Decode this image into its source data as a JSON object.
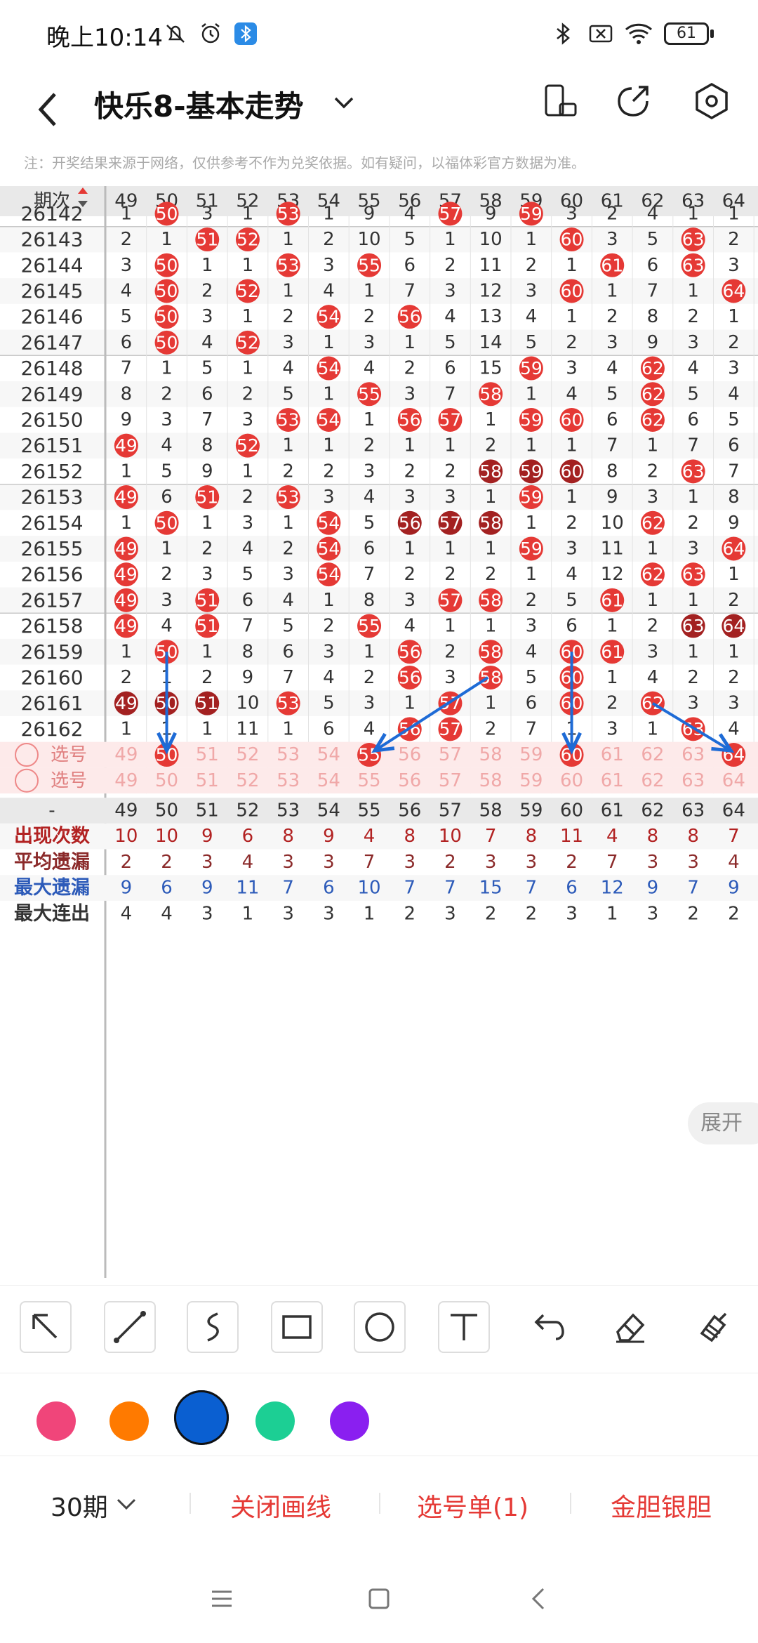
{
  "status": {
    "time": "晚上10:14",
    "battery": "61"
  },
  "app": {
    "title": "快乐8-基本走势"
  },
  "notice": "注：开奖结果来源于网络，仅供参考不作为兑奖依据。如有疑问，以福体彩官方数据为准。",
  "columns": [
    "49",
    "50",
    "51",
    "52",
    "53",
    "54",
    "55",
    "56",
    "57",
    "58",
    "59",
    "60",
    "61",
    "62",
    "63",
    "64"
  ],
  "header_label": "期次",
  "rows": [
    {
      "issue": "26142",
      "cells": [
        "1",
        "50",
        "3",
        "1",
        "53",
        "1",
        "9",
        "4",
        "57",
        "9",
        "59",
        "3",
        "2",
        "4",
        "1",
        "1"
      ],
      "hits": [
        1,
        4,
        8,
        10
      ]
    },
    {
      "issue": "26143",
      "cells": [
        "2",
        "1",
        "51",
        "52",
        "1",
        "2",
        "10",
        "5",
        "1",
        "10",
        "1",
        "60",
        "3",
        "5",
        "63",
        "2"
      ],
      "hits": [
        2,
        3,
        11,
        14
      ]
    },
    {
      "issue": "26144",
      "cells": [
        "3",
        "50",
        "1",
        "1",
        "53",
        "3",
        "55",
        "6",
        "2",
        "11",
        "2",
        "1",
        "61",
        "6",
        "63",
        "3"
      ],
      "hits": [
        1,
        4,
        6,
        12,
        14
      ]
    },
    {
      "issue": "26145",
      "cells": [
        "4",
        "50",
        "2",
        "52",
        "1",
        "4",
        "1",
        "7",
        "3",
        "12",
        "3",
        "60",
        "1",
        "7",
        "1",
        "64"
      ],
      "hits": [
        1,
        3,
        11,
        15
      ]
    },
    {
      "issue": "26146",
      "cells": [
        "5",
        "50",
        "3",
        "1",
        "2",
        "54",
        "2",
        "56",
        "4",
        "13",
        "4",
        "1",
        "2",
        "8",
        "2",
        "1"
      ],
      "hits": [
        1,
        5,
        7
      ]
    },
    {
      "issue": "26147",
      "cells": [
        "6",
        "50",
        "4",
        "52",
        "3",
        "1",
        "3",
        "1",
        "5",
        "14",
        "5",
        "2",
        "3",
        "9",
        "3",
        "2"
      ],
      "hits": [
        1,
        3
      ]
    },
    {
      "issue": "26148",
      "cells": [
        "7",
        "1",
        "5",
        "1",
        "4",
        "54",
        "4",
        "2",
        "6",
        "15",
        "59",
        "3",
        "4",
        "62",
        "4",
        "3"
      ],
      "hits": [
        5,
        10,
        13
      ]
    },
    {
      "issue": "26149",
      "cells": [
        "8",
        "2",
        "6",
        "2",
        "5",
        "1",
        "55",
        "3",
        "7",
        "58",
        "1",
        "4",
        "5",
        "62",
        "5",
        "4"
      ],
      "hits": [
        6,
        9,
        13
      ]
    },
    {
      "issue": "26150",
      "cells": [
        "9",
        "3",
        "7",
        "3",
        "53",
        "54",
        "1",
        "56",
        "57",
        "1",
        "59",
        "60",
        "6",
        "62",
        "6",
        "5"
      ],
      "hits": [
        4,
        5,
        7,
        8,
        10,
        11,
        13
      ]
    },
    {
      "issue": "26151",
      "cells": [
        "49",
        "4",
        "8",
        "52",
        "1",
        "1",
        "2",
        "1",
        "1",
        "2",
        "1",
        "1",
        "7",
        "1",
        "7",
        "6"
      ],
      "hits": [
        0,
        3
      ]
    },
    {
      "issue": "26152",
      "cells": [
        "1",
        "5",
        "9",
        "1",
        "2",
        "2",
        "3",
        "2",
        "2",
        "58",
        "59",
        "60",
        "8",
        "2",
        "63",
        "7"
      ],
      "hits": [
        14
      ],
      "darkhits": [
        9,
        10,
        11
      ]
    },
    {
      "issue": "26153",
      "cells": [
        "49",
        "6",
        "51",
        "2",
        "53",
        "3",
        "4",
        "3",
        "3",
        "1",
        "59",
        "1",
        "9",
        "3",
        "1",
        "8"
      ],
      "hits": [
        0,
        2,
        4,
        10
      ]
    },
    {
      "issue": "26154",
      "cells": [
        "1",
        "50",
        "1",
        "3",
        "1",
        "54",
        "5",
        "56",
        "57",
        "58",
        "1",
        "2",
        "10",
        "62",
        "2",
        "9"
      ],
      "hits": [
        1,
        5,
        13
      ],
      "darkhits": [
        7,
        8,
        9
      ]
    },
    {
      "issue": "26155",
      "cells": [
        "49",
        "1",
        "2",
        "4",
        "2",
        "54",
        "6",
        "1",
        "1",
        "1",
        "59",
        "3",
        "11",
        "1",
        "3",
        "64"
      ],
      "hits": [
        0,
        5,
        10,
        15
      ]
    },
    {
      "issue": "26156",
      "cells": [
        "49",
        "2",
        "3",
        "5",
        "3",
        "54",
        "7",
        "2",
        "2",
        "2",
        "1",
        "4",
        "12",
        "62",
        "63",
        "1"
      ],
      "hits": [
        0,
        5,
        13,
        14
      ]
    },
    {
      "issue": "26157",
      "cells": [
        "49",
        "3",
        "51",
        "6",
        "4",
        "1",
        "8",
        "3",
        "57",
        "58",
        "2",
        "5",
        "61",
        "1",
        "1",
        "2"
      ],
      "hits": [
        0,
        2,
        8,
        9,
        12
      ]
    },
    {
      "issue": "26158",
      "cells": [
        "49",
        "4",
        "51",
        "7",
        "5",
        "2",
        "55",
        "4",
        "1",
        "1",
        "3",
        "6",
        "1",
        "2",
        "63",
        "64"
      ],
      "hits": [
        0,
        2,
        6
      ],
      "darkhits": [
        14,
        15
      ]
    },
    {
      "issue": "26159",
      "cells": [
        "1",
        "50",
        "1",
        "8",
        "6",
        "3",
        "1",
        "56",
        "2",
        "58",
        "4",
        "60",
        "61",
        "3",
        "1",
        "1"
      ],
      "hits": [
        1,
        7,
        9,
        11,
        12
      ]
    },
    {
      "issue": "26160",
      "cells": [
        "2",
        "1",
        "2",
        "9",
        "7",
        "4",
        "2",
        "56",
        "3",
        "58",
        "5",
        "60",
        "1",
        "4",
        "2",
        "2"
      ],
      "hits": [
        7,
        9,
        11
      ]
    },
    {
      "issue": "26161",
      "cells": [
        "49",
        "50",
        "51",
        "10",
        "53",
        "5",
        "3",
        "1",
        "57",
        "1",
        "6",
        "60",
        "2",
        "62",
        "3",
        "3"
      ],
      "hits": [
        4,
        8,
        11,
        13
      ],
      "darkhits": [
        0,
        1,
        2
      ]
    },
    {
      "issue": "26162",
      "cells": [
        "1",
        "1",
        "1",
        "11",
        "1",
        "6",
        "4",
        "56",
        "57",
        "2",
        "7",
        "1",
        "3",
        "1",
        "63",
        "4"
      ],
      "hits": [
        7,
        8,
        14
      ]
    }
  ],
  "select_rows": [
    {
      "label": "选号",
      "selected": [
        1,
        6,
        11,
        15
      ]
    },
    {
      "label": "选号",
      "selected": []
    }
  ],
  "stats_header_label": "-",
  "stats": [
    {
      "label": "出现次数",
      "values": [
        "10",
        "10",
        "9",
        "6",
        "8",
        "9",
        "4",
        "8",
        "10",
        "7",
        "8",
        "11",
        "4",
        "8",
        "8",
        "7"
      ],
      "color": "#b22222"
    },
    {
      "label": "平均遗漏",
      "values": [
        "2",
        "2",
        "3",
        "4",
        "3",
        "3",
        "7",
        "3",
        "2",
        "3",
        "3",
        "2",
        "7",
        "3",
        "3",
        "4"
      ],
      "color": "#8b2a2a"
    },
    {
      "label": "最大遗漏",
      "values": [
        "9",
        "6",
        "9",
        "11",
        "7",
        "6",
        "10",
        "7",
        "7",
        "15",
        "7",
        "6",
        "12",
        "9",
        "7",
        "9"
      ],
      "color": "#2d5bb9"
    },
    {
      "label": "最大连出",
      "values": [
        "4",
        "4",
        "3",
        "1",
        "3",
        "3",
        "1",
        "2",
        "3",
        "2",
        "2",
        "3",
        "1",
        "3",
        "2",
        "2"
      ],
      "color": "#333333"
    }
  ],
  "expand_label": "展开",
  "draw_tools": [
    "arrow-tool",
    "line-tool",
    "curve-tool",
    "rect-tool",
    "circle-tool",
    "text-tool",
    "undo-tool",
    "eraser-tool",
    "clear-tool"
  ],
  "palette": [
    "#f0457a",
    "#ff7a00",
    "#0a5fd1",
    "#1ccf94",
    "#8a1ff0"
  ],
  "bottom": {
    "period": "30期",
    "close_draw": "关闭画线",
    "pick_list": "选号单(1)",
    "gold_silver": "金胆银胆"
  },
  "colors": {
    "accent": "#e53935",
    "dark_ball": "#a32121",
    "arrow": "#1e6bd6"
  }
}
